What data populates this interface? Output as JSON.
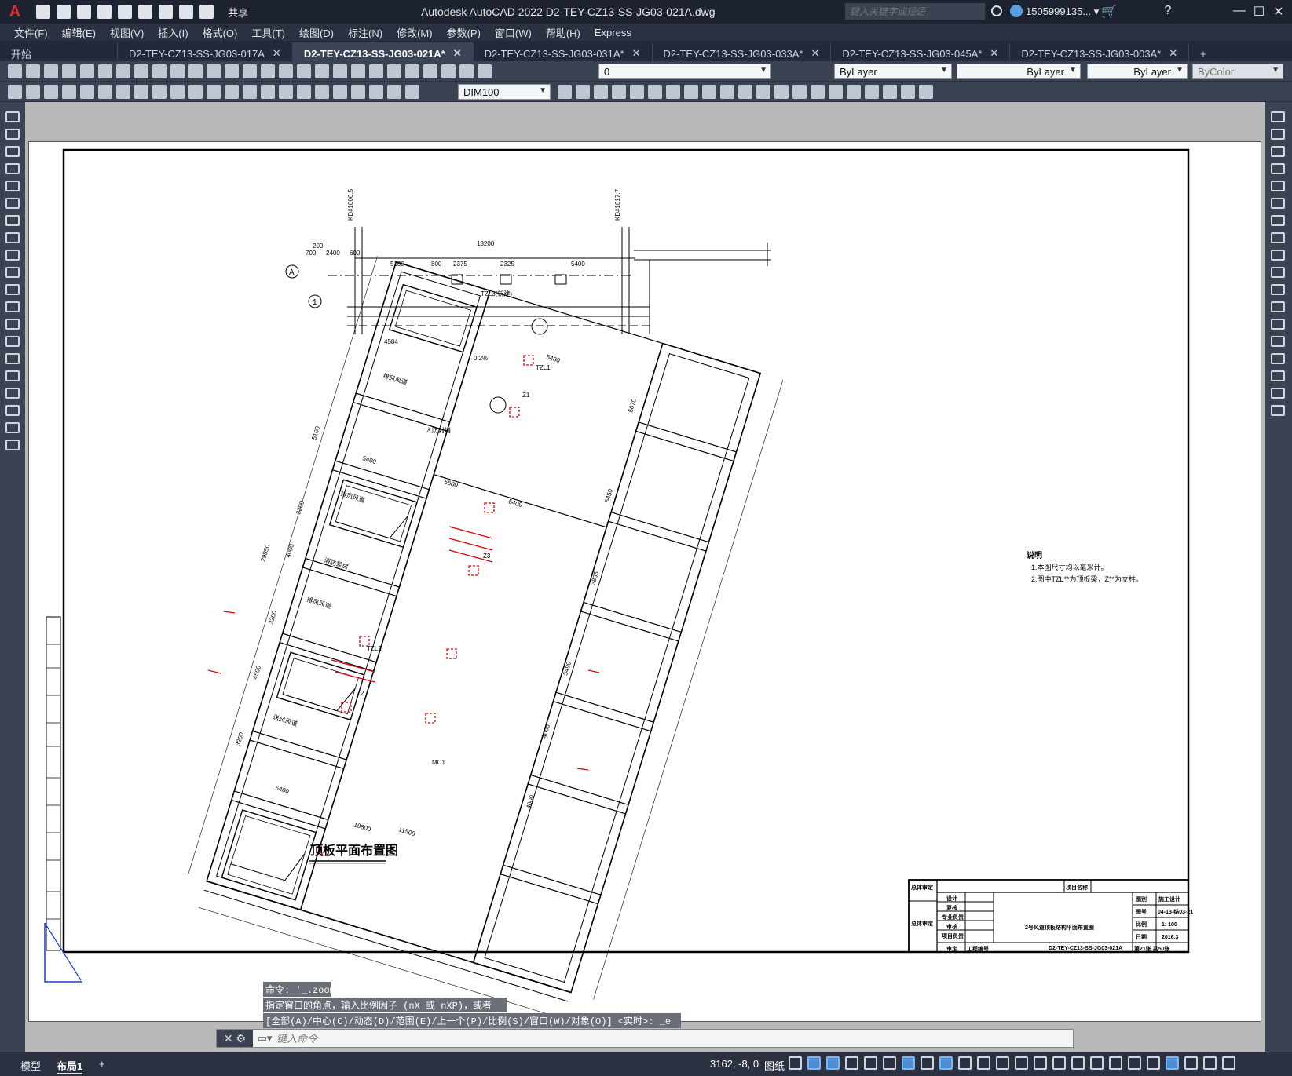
{
  "app": {
    "title": "Autodesk AutoCAD 2022    D2-TEY-CZ13-SS-JG03-021A.dwg",
    "share": "共享",
    "search_placeholder": "键入关键字或短语",
    "user": "1505999135... ▾"
  },
  "menu": [
    "文件(F)",
    "编辑(E)",
    "视图(V)",
    "插入(I)",
    "格式(O)",
    "工具(T)",
    "绘图(D)",
    "标注(N)",
    "修改(M)",
    "参数(P)",
    "窗口(W)",
    "帮助(H)",
    "Express"
  ],
  "tabs": [
    {
      "label": "开始",
      "active": false,
      "closable": false
    },
    {
      "label": "D2-TEY-CZ13-SS-JG03-017A",
      "active": false,
      "closable": true
    },
    {
      "label": "D2-TEY-CZ13-SS-JG03-021A*",
      "active": true,
      "closable": true
    },
    {
      "label": "D2-TEY-CZ13-SS-JG03-031A*",
      "active": false,
      "closable": true
    },
    {
      "label": "D2-TEY-CZ13-SS-JG03-033A*",
      "active": false,
      "closable": true
    },
    {
      "label": "D2-TEY-CZ13-SS-JG03-045A*",
      "active": false,
      "closable": true
    },
    {
      "label": "D2-TEY-CZ13-SS-JG03-003A*",
      "active": false,
      "closable": true
    }
  ],
  "toolbar": {
    "layer": "0",
    "color": "ByLayer",
    "linetype": "ByLayer",
    "lineweight": "ByLayer",
    "plotstyle": "ByColor",
    "dimstyle": "DIM100"
  },
  "drawing": {
    "title": "顶板平面布置图",
    "notes_title": "说明",
    "notes": [
      "1.本图尺寸均以毫米计。",
      "2.图中TZL**为顶板梁，Z**为立柱。"
    ],
    "dims": {
      "d200": "200",
      "d700": "700",
      "d2400": "2400",
      "d600": "600",
      "d18200": "18200",
      "d5160": "5160",
      "d2375": "2375",
      "d2325": "2325",
      "d5400": "5400",
      "d800": "800",
      "d5600": "5600",
      "d19800": "19800",
      "d11500": "11500",
      "d5100": "5100",
      "d3200": "3200",
      "d4000": "4000",
      "d4500": "4500",
      "d29850": "29850",
      "d5670": "5670",
      "d6450": "6450",
      "d3835": "3835",
      "d5490": "5490",
      "d4650": "4650",
      "d4580": "4580",
      "d4584": "4584"
    },
    "labels": {
      "rooms": [
        "排风风道",
        "消防泵房",
        "排风风道",
        "送风风道"
      ],
      "wall": "人防封堵",
      "slope": "0.2%",
      "axis_a": "A",
      "axis_1": "1",
      "beams": [
        "TZL1",
        "TZL2",
        "TZL3(新建)",
        "Z1",
        "Z2",
        "Z3",
        "MC1"
      ]
    }
  },
  "titleblock": {
    "project": "项目名称",
    "drawing_name": "2号风道顶板结构平面布置图",
    "drawing_no": "D2-TEY-CZ13-SS-JG03-021A",
    "phase": "施工设计",
    "chart_no": "04-13-结03-21",
    "scale": "1: 100",
    "date": "2016.3",
    "sheet": "第21张  共50张",
    "rows_left": [
      "总体审定",
      "总体审定"
    ],
    "roles": [
      "设计",
      "复核",
      "专业负责",
      "审核",
      "项目负责",
      "审定"
    ],
    "right_labels": [
      "图别",
      "图号",
      "比例",
      "日期"
    ],
    "footer_left": "工程编号"
  },
  "command": {
    "history": [
      "命令: '_.zoom",
      "指定窗口的角点，输入比例因子 (nX 或 nXP)，或者",
      "[全部(A)/中心(C)/动态(D)/范围(E)/上一个(P)/比例(S)/窗口(W)/对象(O)] <实时>: _e"
    ],
    "placeholder": "键入命令"
  },
  "status": {
    "layout_tabs": [
      "模型",
      "布局1",
      "+"
    ],
    "coords": "3162, -8, 0",
    "paper": "图纸"
  }
}
